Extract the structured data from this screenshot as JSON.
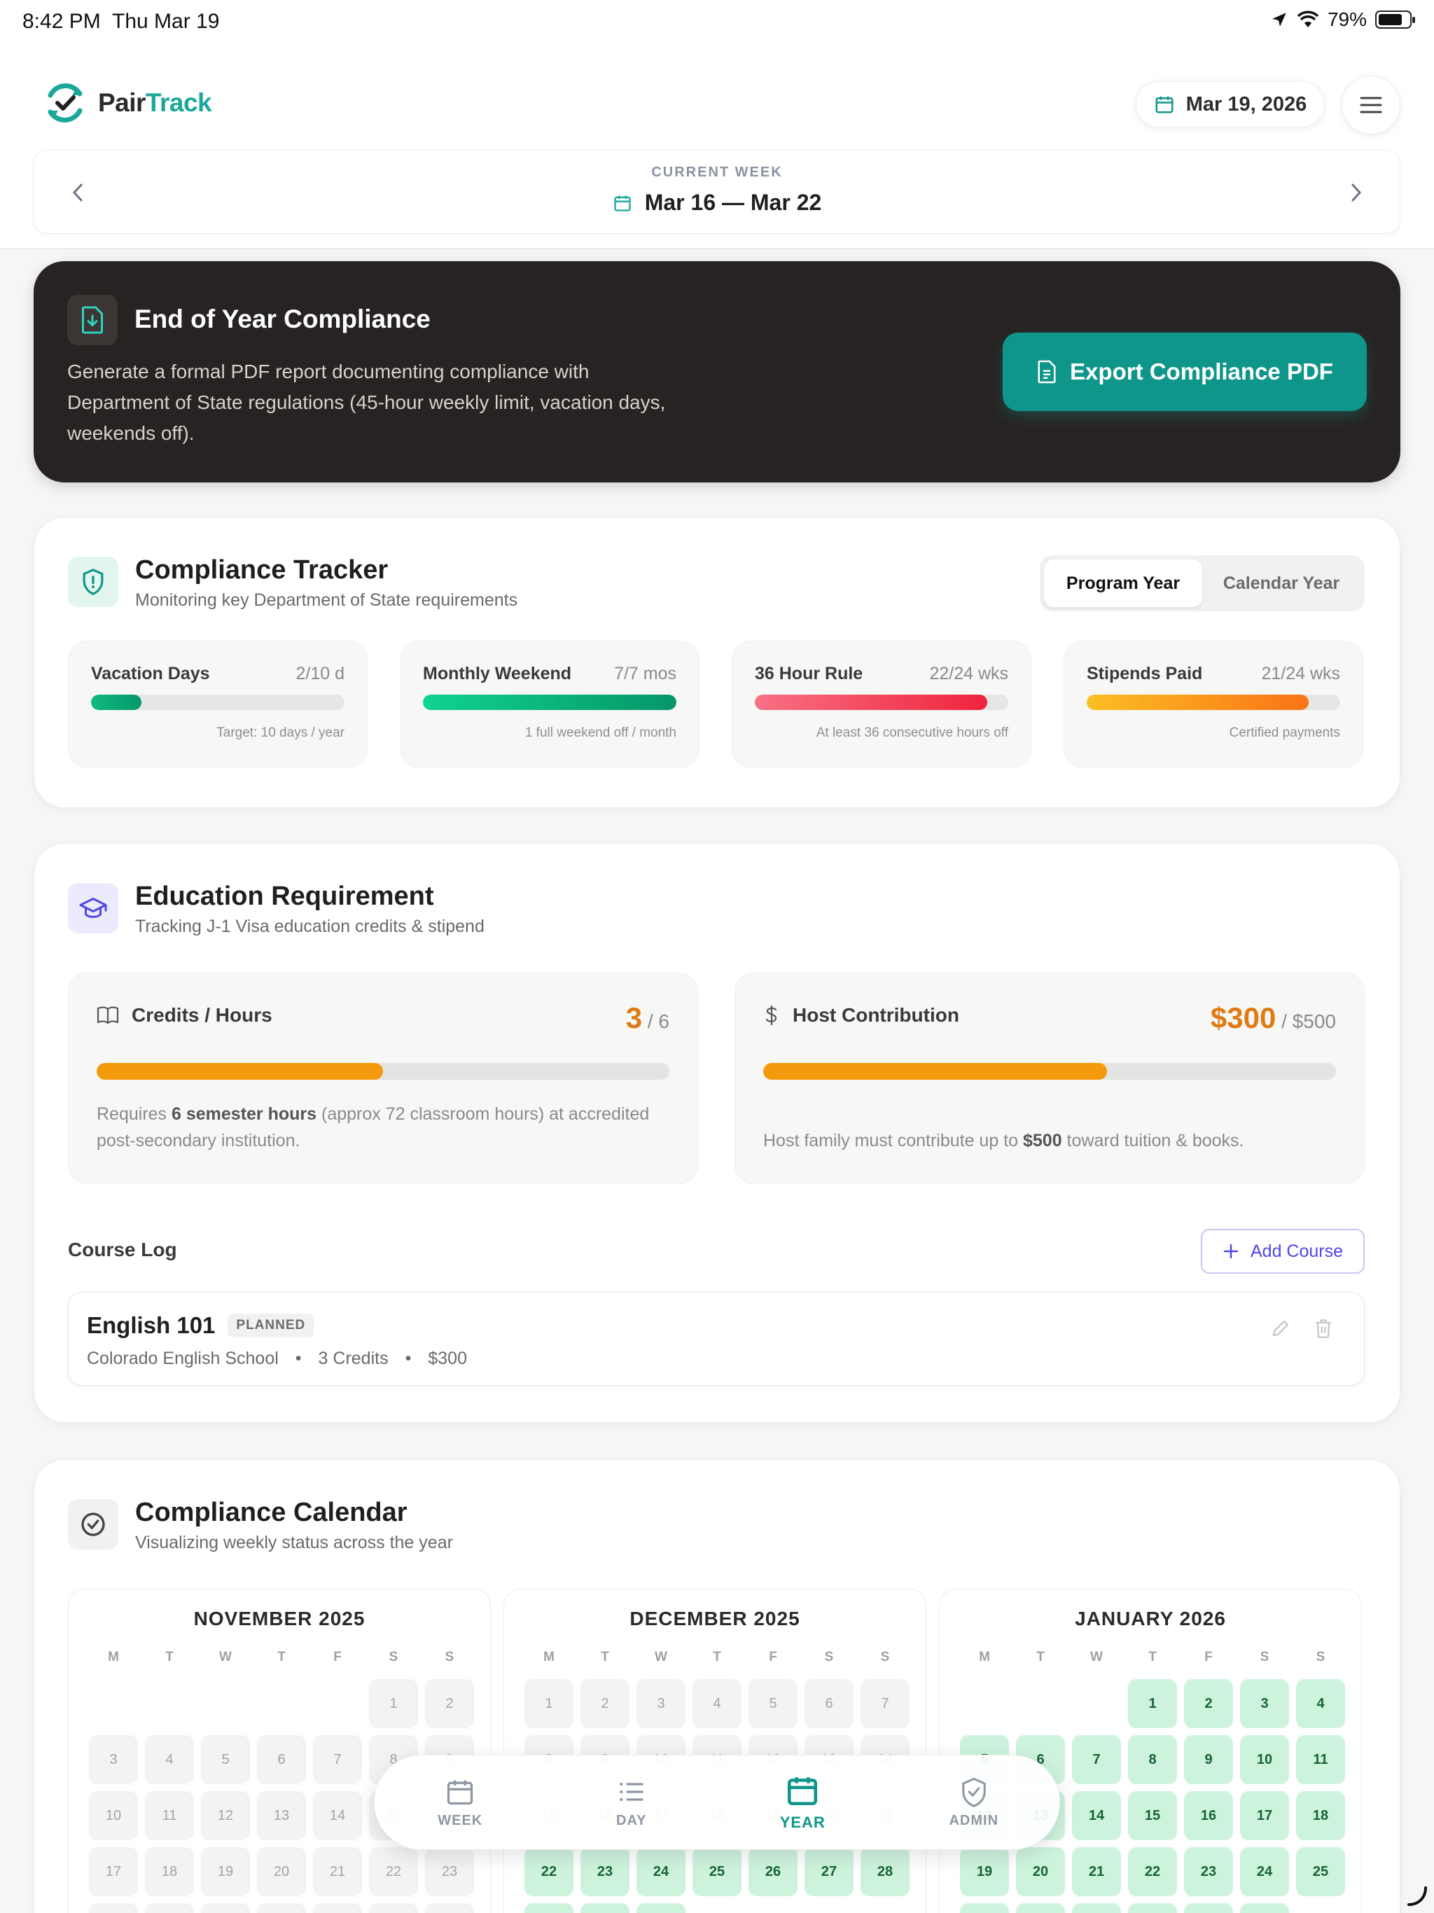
{
  "status_bar": {
    "time": "8:42 PM",
    "date": "Thu Mar 19",
    "battery": "79%"
  },
  "header": {
    "logo_part1": "Pair",
    "logo_part2": "Track",
    "date_pill": "Mar 19, 2026"
  },
  "week": {
    "label": "CURRENT WEEK",
    "range": "Mar 16 — Mar 22"
  },
  "banner": {
    "title": "End of Year Compliance",
    "description": "Generate a formal PDF report documenting compliance with Department of State regulations (45-hour weekly limit, vacation days, weekends off).",
    "button": "Export Compliance PDF"
  },
  "tracker": {
    "title": "Compliance Tracker",
    "subtitle": "Monitoring key Department of State requirements",
    "toggle": [
      "Program Year",
      "Calendar Year"
    ],
    "metrics": [
      {
        "name": "Vacation Days",
        "value": "2/10 d",
        "progress": 0.2,
        "note": "Target: 10 days / year",
        "color_from": "#10b981",
        "color_to": "#059669"
      },
      {
        "name": "Monthly Weekend",
        "value": "7/7 mos",
        "progress": 1.0,
        "note": "1 full weekend off / month",
        "color_from": "#10d38f",
        "color_to": "#059669"
      },
      {
        "name": "36 Hour Rule",
        "value": "22/24 wks",
        "progress": 0.917,
        "note": "At least 36 consecutive hours off",
        "color_from": "#f87185",
        "color_to": "#ef233c"
      },
      {
        "name": "Stipends Paid",
        "value": "21/24 wks",
        "progress": 0.875,
        "note": "Certified payments",
        "color_from": "#fbbf24",
        "color_to": "#f97316"
      }
    ]
  },
  "education": {
    "title": "Education Requirement",
    "subtitle": "Tracking J-1 Visa education credits & stipend",
    "credits": {
      "label": "Credits / Hours",
      "value": "3",
      "total": "/ 6",
      "progress": 0.5,
      "note_pre": "Requires ",
      "note_bold": "6 semester hours",
      "note_post": " (approx 72 classroom hours) at accredited post-secondary institution."
    },
    "host": {
      "label": "Host Contribution",
      "value": "$300",
      "total": "/ $500",
      "progress": 0.6,
      "note_pre": "Host family must contribute up to ",
      "note_bold": "$500",
      "note_post": " toward tuition & books."
    },
    "course_log_title": "Course Log",
    "add_course": "Add Course",
    "courses": [
      {
        "name": "English 101",
        "status": "PLANNED",
        "school": "Colorado English School",
        "credits": "3 Credits",
        "cost": "$300"
      }
    ]
  },
  "calendar": {
    "title": "Compliance Calendar",
    "subtitle": "Visualizing weekly status across the year",
    "weekdays": [
      "M",
      "T",
      "W",
      "T",
      "F",
      "S",
      "S"
    ],
    "months": [
      {
        "name": "NOVEMBER 2025",
        "offset": 5,
        "days": 30,
        "ok_from": 999
      },
      {
        "name": "DECEMBER 2025",
        "offset": 0,
        "days": 31,
        "ok_from": 22
      },
      {
        "name": "JANUARY 2026",
        "offset": 3,
        "days": 31,
        "ok_from": 1
      }
    ]
  },
  "nav": [
    {
      "label": "WEEK",
      "icon": "calendar-icon",
      "active": false
    },
    {
      "label": "DAY",
      "icon": "list-icon",
      "active": false
    },
    {
      "label": "YEAR",
      "icon": "calendar-icon",
      "active": true
    },
    {
      "label": "ADMIN",
      "icon": "shield-check-icon",
      "active": false
    }
  ],
  "colors": {
    "accent": "#0f968a",
    "brand": "#1ba89a",
    "orange": "#e07a12",
    "indigo": "#4f46e5"
  }
}
